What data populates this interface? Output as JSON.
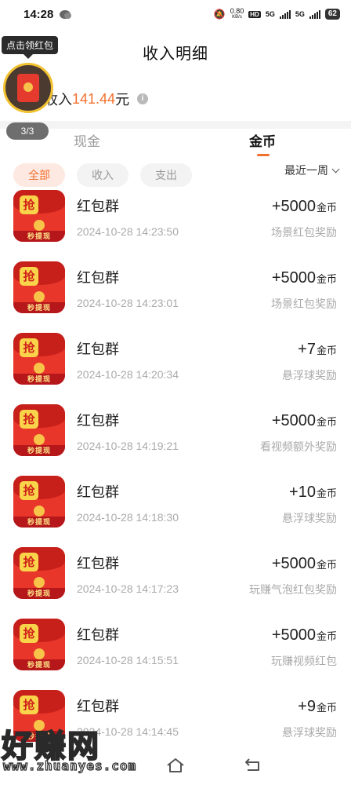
{
  "status_bar": {
    "time": "14:28",
    "net_speed": "0.80",
    "net_unit": "KB/s",
    "hd_label": "HD",
    "sim1": "5G",
    "sim2": "5G",
    "battery": "62"
  },
  "header": {
    "title": "收入明细"
  },
  "floating_packet": {
    "tip": "点击领红包",
    "counter": "3/3"
  },
  "summary": {
    "prefix": "收入",
    "amount": "141.44",
    "suffix": "元",
    "info_glyph": "i"
  },
  "tabs": {
    "cash": "现金",
    "coins": "金币",
    "active": "coins",
    "accent_color": "#f2702d"
  },
  "filters": {
    "all": "全部",
    "income": "收入",
    "expense": "支出",
    "selected": "all",
    "period": "最近一周"
  },
  "transactions": [
    {
      "title": "红包群",
      "time": "2024-10-28 14:23:50",
      "amount": "+5000",
      "unit": "金币",
      "source": "场景红包奖励",
      "icon": "red-packet-app-icon",
      "icon_char": "抢",
      "icon_strip": "秒提现"
    },
    {
      "title": "红包群",
      "time": "2024-10-28 14:23:01",
      "amount": "+5000",
      "unit": "金币",
      "source": "场景红包奖励",
      "icon": "red-packet-app-icon",
      "icon_char": "抢",
      "icon_strip": "秒提现"
    },
    {
      "title": "红包群",
      "time": "2024-10-28 14:20:34",
      "amount": "+7",
      "unit": "金币",
      "source": "悬浮球奖励",
      "icon": "red-packet-app-icon",
      "icon_char": "抢",
      "icon_strip": "秒提现"
    },
    {
      "title": "红包群",
      "time": "2024-10-28 14:19:21",
      "amount": "+5000",
      "unit": "金币",
      "source": "看视频额外奖励",
      "icon": "red-packet-app-icon",
      "icon_char": "抢",
      "icon_strip": "秒提现"
    },
    {
      "title": "红包群",
      "time": "2024-10-28 14:18:30",
      "amount": "+10",
      "unit": "金币",
      "source": "悬浮球奖励",
      "icon": "red-packet-app-icon",
      "icon_char": "抢",
      "icon_strip": "秒提现"
    },
    {
      "title": "红包群",
      "time": "2024-10-28 14:17:23",
      "amount": "+5000",
      "unit": "金币",
      "source": "玩赚气泡红包奖励",
      "icon": "red-packet-app-icon",
      "icon_char": "抢",
      "icon_strip": "秒提现"
    },
    {
      "title": "红包群",
      "time": "2024-10-28 14:15:51",
      "amount": "+5000",
      "unit": "金币",
      "source": "玩赚视频红包",
      "icon": "red-packet-app-icon",
      "icon_char": "抢",
      "icon_strip": "秒提现"
    },
    {
      "title": "红包群",
      "time": "2024-10-28 14:14:45",
      "amount": "+9",
      "unit": "金币",
      "source": "悬浮球奖励",
      "icon": "red-packet-app-icon",
      "icon_char": "抢",
      "icon_strip": "秒提现"
    }
  ],
  "watermark": {
    "text": "好赚网",
    "url": "www.zhuanyes.com"
  },
  "nav_bar": {
    "home_icon": "home-icon",
    "back_icon": "back-icon"
  }
}
